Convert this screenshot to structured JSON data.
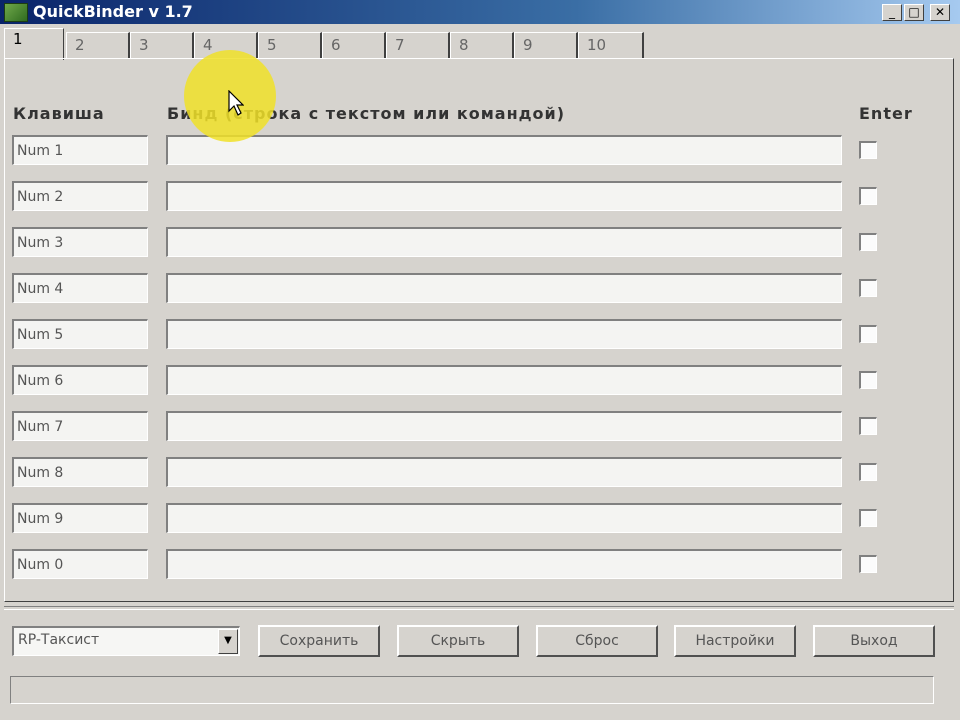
{
  "window": {
    "title": "QuickBinder v 1.7",
    "controls": {
      "minimize_glyph": "_",
      "maximize_glyph": "□",
      "close_glyph": "✕"
    }
  },
  "tabs": [
    {
      "label": "1",
      "active": true
    },
    {
      "label": "2",
      "active": false
    },
    {
      "label": "3",
      "active": false
    },
    {
      "label": "4",
      "active": false
    },
    {
      "label": "5",
      "active": false
    },
    {
      "label": "6",
      "active": false
    },
    {
      "label": "7",
      "active": false
    },
    {
      "label": "8",
      "active": false
    },
    {
      "label": "9",
      "active": false
    },
    {
      "label": "10",
      "active": false
    }
  ],
  "headers": {
    "key": "Клавиша",
    "bind": "Бинд (строка с текстом или командой)",
    "enter": "Enter"
  },
  "rows": [
    {
      "key": "Num 1",
      "bind": "",
      "enter": false
    },
    {
      "key": "Num 2",
      "bind": "",
      "enter": false
    },
    {
      "key": "Num 3",
      "bind": "",
      "enter": false
    },
    {
      "key": "Num 4",
      "bind": "",
      "enter": false
    },
    {
      "key": "Num 5",
      "bind": "",
      "enter": false
    },
    {
      "key": "Num 6",
      "bind": "",
      "enter": false
    },
    {
      "key": "Num 7",
      "bind": "",
      "enter": false
    },
    {
      "key": "Num 8",
      "bind": "",
      "enter": false
    },
    {
      "key": "Num 9",
      "bind": "",
      "enter": false
    },
    {
      "key": "Num 0",
      "bind": "",
      "enter": false
    }
  ],
  "profile": {
    "selected": "RP-Таксист"
  },
  "buttons": {
    "save": "Сохранить",
    "hide": "Скрыть",
    "reset": "Сброс",
    "settings": "Настройки",
    "exit": "Выход"
  },
  "colors": {
    "titlebar_start": "#0a246a",
    "titlebar_end": "#a6caf0",
    "face": "#d6d3ce",
    "cursor_highlight": "#f0e028"
  },
  "icons": {
    "app": "quickbinder-app-icon",
    "cursor": "mouse-pointer-icon",
    "dropdown": "chevron-down-icon"
  }
}
